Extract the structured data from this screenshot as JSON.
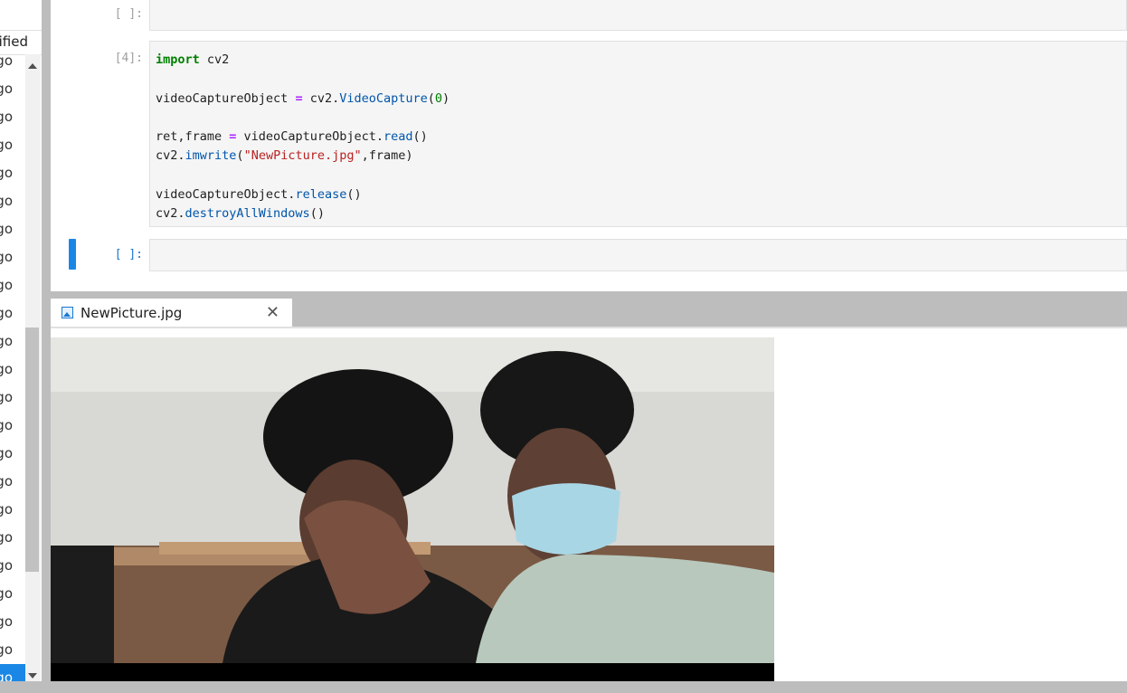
{
  "filebrowser": {
    "column_header": "ified",
    "rows": [
      "go",
      "go",
      "go",
      "go",
      "go",
      "go",
      "go",
      "go",
      "go",
      "go",
      "go",
      "go",
      "go",
      "go",
      "go",
      "go",
      "go",
      "go",
      "go",
      "go",
      "go",
      "go",
      "go"
    ],
    "selected_index": 22
  },
  "notebook": {
    "cells": [
      {
        "prompt": "[ ]:",
        "code": ""
      },
      {
        "prompt": "[4]:",
        "code": "import cv2\n\nvideoCaptureObject = cv2.VideoCapture(0)\n\nret,frame = videoCaptureObject.read()\ncv2.imwrite(\"NewPicture.jpg\",frame)\n\nvideoCaptureObject.release()\ncv2.destroyAllWindows()"
      },
      {
        "prompt": "[ ]:",
        "code": ""
      }
    ]
  },
  "viewer": {
    "tab_title": "NewPicture.jpg",
    "close_glyph": "✕",
    "icon": "image-icon",
    "image_description_alt": "photo"
  },
  "colors": {
    "accent": "#1a87e6",
    "keyword": "#008000",
    "string": "#ba2121",
    "function": "#0055aa"
  }
}
